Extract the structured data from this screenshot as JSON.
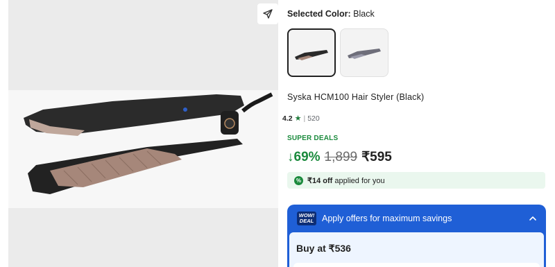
{
  "product": {
    "selected_color_label": "Selected Color:",
    "selected_color_value": "Black",
    "title": "Syska HCM100 Hair Styler (Black)",
    "rating": "4.2",
    "rating_count": "520",
    "deal_tag": "SUPER DEALS",
    "discount": "↓69%",
    "mrp": "1,899",
    "price": "₹595",
    "colors": [
      "Black",
      "Grey"
    ]
  },
  "applied_offer": {
    "amount": "₹14 off",
    "suffix": "applied for you",
    "badge": "%"
  },
  "offers_panel": {
    "badge_line1": "WOW!",
    "badge_line2": "DEAL",
    "heading": "Apply offers for maximum savings",
    "buy_at": "Buy at ₹536"
  },
  "icons": {
    "share": "share-icon",
    "star": "star-icon",
    "chevron": "chevron-up-icon"
  },
  "colors": {
    "green": "#1a8a3c",
    "offer_blue": "#1f5fd6",
    "light_green_bg": "#eaf7ee"
  }
}
